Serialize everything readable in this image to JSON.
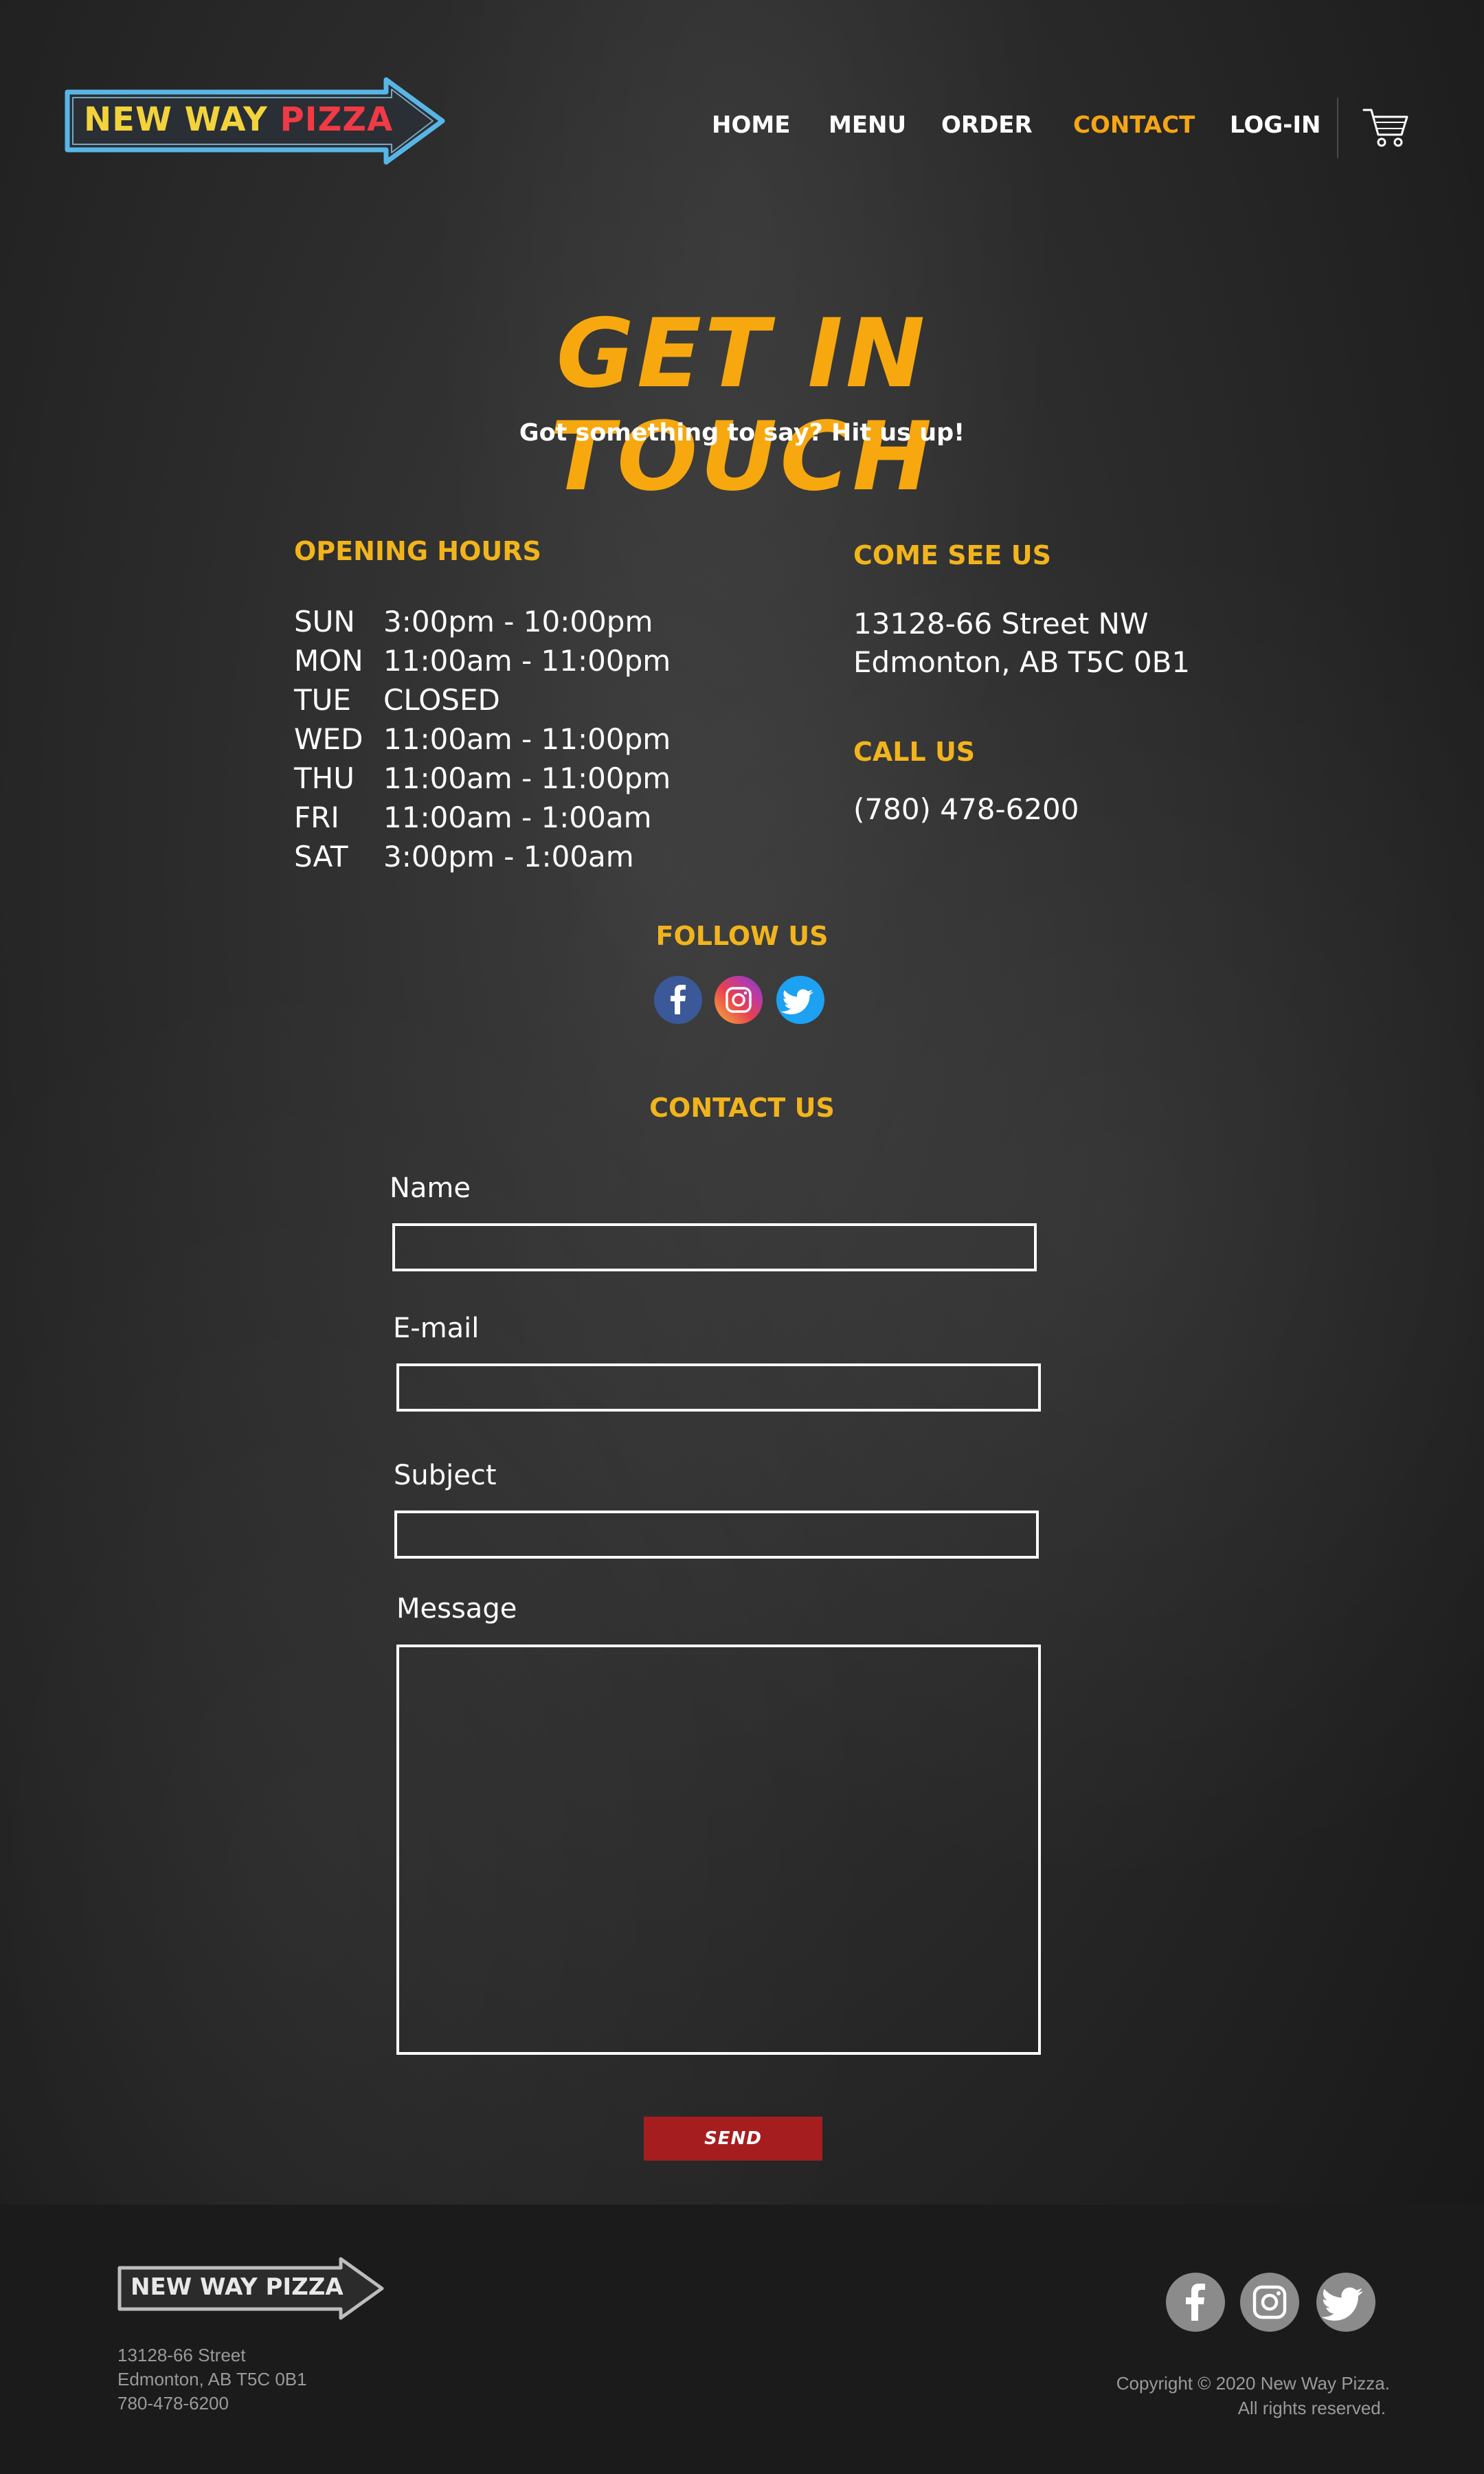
{
  "brand": {
    "logo_word1": "NEW WAY",
    "logo_word2": "PIZZA",
    "footer_logo": "NEW WAY PIZZA"
  },
  "nav": {
    "items": [
      {
        "label": "HOME"
      },
      {
        "label": "MENU"
      },
      {
        "label": "ORDER"
      },
      {
        "label": "CONTACT",
        "active": true
      },
      {
        "label": "LOG-IN"
      }
    ],
    "cart_icon": "shopping-cart-icon"
  },
  "hero": {
    "title": "GET IN TOUCH",
    "subtitle": "Got something to say? Hit us up!"
  },
  "hours": {
    "heading": "OPENING HOURS",
    "rows": [
      {
        "day": "SUN",
        "time": "3:00pm - 10:00pm"
      },
      {
        "day": "MON",
        "time": "11:00am - 11:00pm"
      },
      {
        "day": "TUE",
        "time": "CLOSED"
      },
      {
        "day": "WED",
        "time": "11:00am - 11:00pm"
      },
      {
        "day": "THU",
        "time": "11:00am - 11:00pm"
      },
      {
        "day": "FRI",
        "time": "11:00am - 1:00am"
      },
      {
        "day": "SAT",
        "time": "3:00pm - 1:00am"
      }
    ]
  },
  "location": {
    "heading": "COME SEE US",
    "line1": "13128-66 Street NW",
    "line2": "Edmonton, AB T5C 0B1"
  },
  "phone": {
    "heading": "CALL US",
    "number": "(780) 478-6200"
  },
  "follow": {
    "heading": "FOLLOW US",
    "icons": [
      "facebook-icon",
      "instagram-icon",
      "twitter-icon"
    ]
  },
  "form": {
    "heading": "CONTACT US",
    "name_label": "Name",
    "name_value": "",
    "email_label": "E-mail",
    "email_value": "",
    "subject_label": "Subject",
    "subject_value": "",
    "message_label": "Message",
    "message_value": "",
    "send_label": "SEND"
  },
  "footer": {
    "address1": "13128-66 Street",
    "address2": "Edmonton, AB T5C 0B1",
    "phone": "780-478-6200",
    "copyright": "Copyright © 2020 New Way Pizza.",
    "rights": "All rights reserved."
  },
  "colors": {
    "accent_orange": "#f5a515",
    "heading_yellow": "#f1b41c",
    "send_red": "#a61d20",
    "facebook": "#3b5998",
    "twitter": "#1da1f2"
  }
}
